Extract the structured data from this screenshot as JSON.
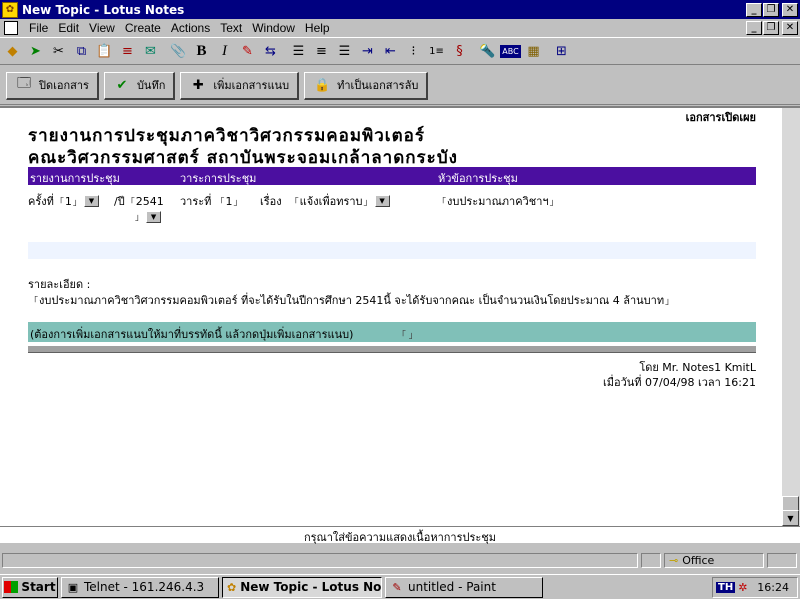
{
  "window": {
    "title": "New Topic - Lotus Notes"
  },
  "menu": {
    "items": [
      "File",
      "Edit",
      "View",
      "Create",
      "Actions",
      "Text",
      "Window",
      "Help"
    ]
  },
  "toolbar": {
    "icons": [
      "open-database-icon",
      "navigate-icon",
      "cut-icon",
      "copy-icon",
      "paste-icon",
      "link-icon",
      "envelope-icon",
      "attach-icon",
      "bold-icon",
      "italic-icon",
      "highlighter-icon",
      "tab-icon",
      "align-left-icon",
      "align-center-icon",
      "align-right-icon",
      "indent-icon",
      "outdent-icon",
      "bullet-list-icon",
      "number-list-icon",
      "spell-icon",
      "search-icon",
      "abc-icon",
      "ruler-icon",
      "table-icon"
    ]
  },
  "actions": {
    "close": "ปิดเอกสาร",
    "save": "บันทึก",
    "attach": "เพิ่มเอกสารแนบ",
    "confidential": "ทำเป็นเอกสารลับ"
  },
  "document": {
    "classification": "เอกสารเปิดเผย",
    "heading1": "รายงานการประชุมภาควิชาวิศวกรรมคอมพิวเตอร์",
    "heading2": "คณะวิศวกรรมศาสตร์ สถาบันพระจอมเกล้าลาดกระบัง",
    "columns": {
      "report": "รายงานการประชุม",
      "agenda": "วาระการประชุม",
      "topic": "หัวข้อการประชุม"
    },
    "fields": {
      "session_label": "ครั้งที่",
      "session_value": "1",
      "year_label": "/ปี",
      "year_value": "2541",
      "agenda_label": "วาระที่",
      "agenda_value": "1",
      "subject_label": "เรื่อง",
      "subject_value": "แจ้งเพื่อทราบ",
      "topic_value": "งบประมาณภาควิชาฯ"
    },
    "detail_label": "รายละเอียด :",
    "detail_text": "งบประมาณภาควิชาวิศวกรรมคอมพิวเตอร์ ที่จะได้รับในปีการศึกษา 2541นี้ จะได้รับจากคณะ เป็นจำนวนเงินโดยประมาณ 4 ล้านบาท",
    "attach_hint": "(ต้องการเพิ่มเอกสารแนบให้มาที่บรรทัดนี้ แล้วกดปุ่มเพิ่มเอกสารแนบ)",
    "author": "โดย Mr. Notes1 KmitL",
    "datetime": "เมื่อวันที่ 07/04/98 เวลา 16:21"
  },
  "hint": "กรุณาใส่ข้อความแสดงเนื้อหาการประชุม",
  "status": {
    "location": "Office"
  },
  "taskbar": {
    "start": "Start",
    "tasks": [
      "Telnet - 161.246.4.3",
      "New Topic - Lotus No...",
      "untitled - Paint"
    ],
    "lang": "TH",
    "time": "16:24"
  }
}
